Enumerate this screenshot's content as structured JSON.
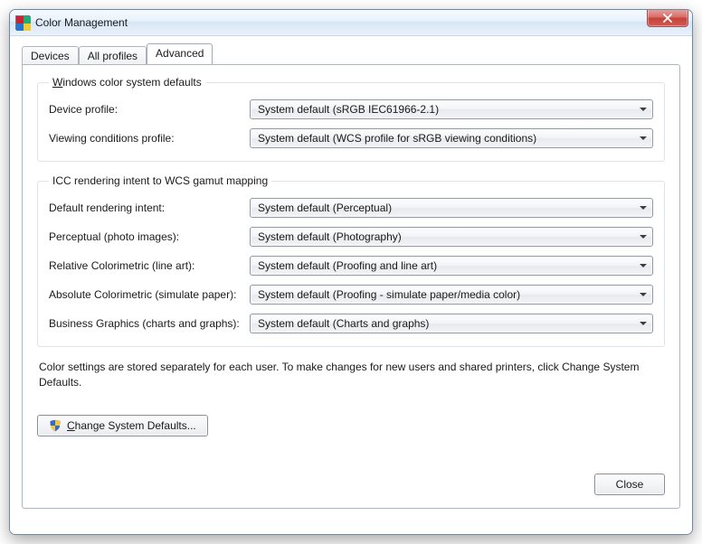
{
  "window": {
    "title": "Color Management",
    "close_tooltip": "Close"
  },
  "tabs": [
    {
      "label": "Devices",
      "active": false
    },
    {
      "label": "All profiles",
      "active": false
    },
    {
      "label": "Advanced",
      "active": true
    }
  ],
  "wcs_defaults": {
    "legend": "Windows color system defaults",
    "device_profile": {
      "label": "Device profile:",
      "value": "System default (sRGB IEC61966-2.1)"
    },
    "viewing_conditions_profile": {
      "label": "Viewing conditions profile:",
      "value": "System default (WCS profile for sRGB viewing conditions)"
    }
  },
  "icc_mapping": {
    "legend": "ICC  rendering intent to WCS gamut mapping",
    "default_rendering_intent": {
      "label": "Default rendering intent:",
      "value": "System default (Perceptual)"
    },
    "perceptual": {
      "label": "Perceptual (photo images):",
      "value": "System default (Photography)"
    },
    "relative_colorimetric": {
      "label": "Relative Colorimetric (line art):",
      "value": "System default (Proofing and line art)"
    },
    "absolute_colorimetric": {
      "label": "Absolute Colorimetric (simulate paper):",
      "value": "System default (Proofing - simulate paper/media color)"
    },
    "business_graphics": {
      "label": "Business Graphics (charts and graphs):",
      "value": "System default (Charts and graphs)"
    }
  },
  "info_text": "Color settings are stored separately for each user. To make changes for new users and shared printers, click Change System Defaults.",
  "buttons": {
    "change_system_defaults": "Change System Defaults...",
    "close": "Close"
  }
}
